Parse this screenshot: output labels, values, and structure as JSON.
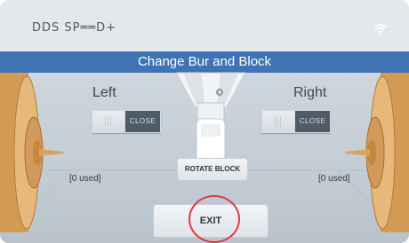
{
  "header": {
    "brand": "DDS SP══D+",
    "wifi_icon": "wifi-icon"
  },
  "screen": {
    "title": "Change Bur and Block"
  },
  "left": {
    "label": "Left",
    "toggle_state": "CLOSE",
    "used_text": "[0 used]"
  },
  "right": {
    "label": "Right",
    "toggle_state": "CLOSE",
    "used_text": "[0 used]"
  },
  "actions": {
    "rotate_label": "ROTATE BLOCK",
    "exit_label": "EXIT"
  },
  "colors": {
    "title_bar": "#3f73b4",
    "toggle_dark": "#4f5b66",
    "highlight_ring": "#e03a44"
  }
}
